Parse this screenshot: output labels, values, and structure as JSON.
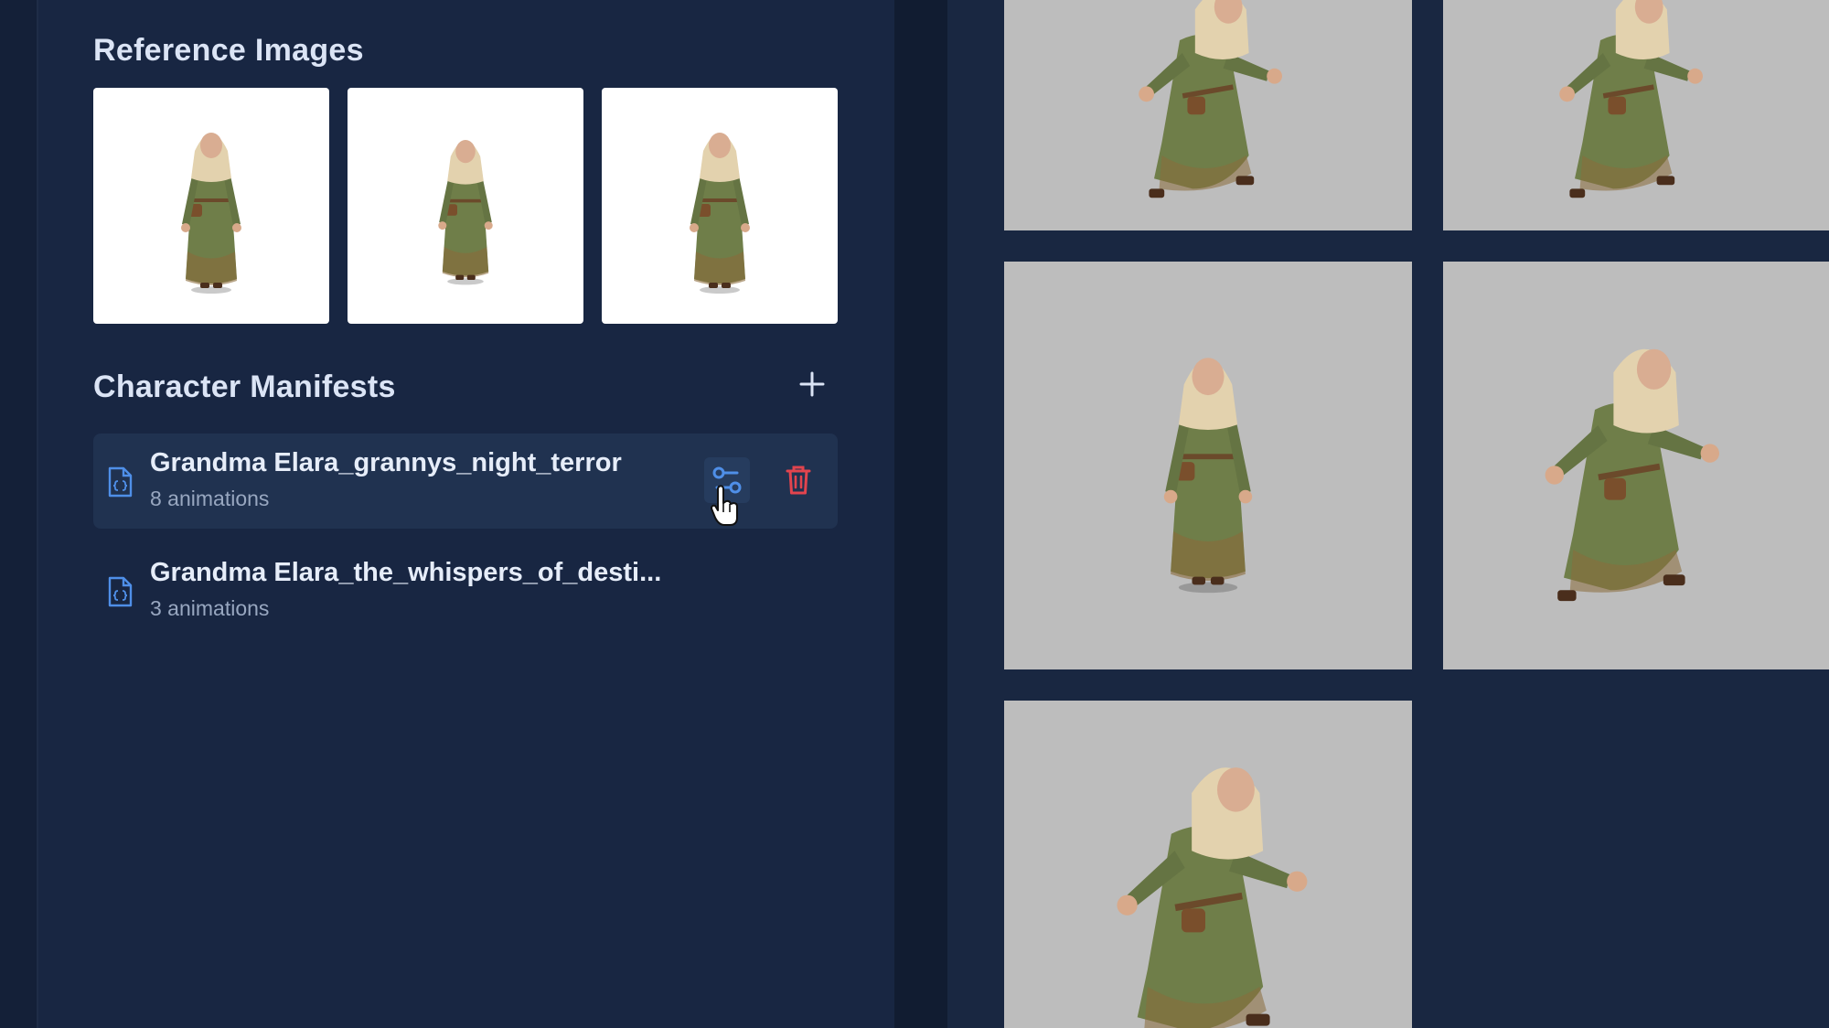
{
  "reference_images": {
    "title": "Reference Images",
    "items": [
      {
        "view": "front"
      },
      {
        "view": "side"
      },
      {
        "view": "back"
      }
    ]
  },
  "manifests": {
    "title": "Character Manifests",
    "add_icon": "plus-icon",
    "items": [
      {
        "name": "Grandma Elara_grannys_night_terror",
        "count": "8 animations",
        "active": true
      },
      {
        "name": "Grandma Elara_the_whispers_of_desti...",
        "count": "3 animations",
        "active": false
      }
    ]
  },
  "frames": [
    {
      "pose": "crouch-reach"
    },
    {
      "pose": "crouch-reach-side"
    },
    {
      "pose": "standing-side"
    },
    {
      "pose": "running"
    },
    {
      "pose": "lunge-reach"
    }
  ],
  "colors": {
    "accent_blue": "#4f8fe8",
    "delete_red": "#e2444e",
    "panel_bg": "#182642"
  }
}
